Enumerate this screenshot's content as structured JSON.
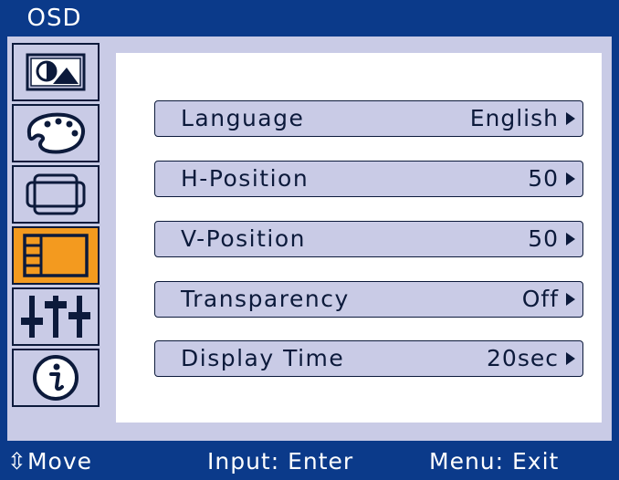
{
  "title": "OSD",
  "sidebar": {
    "items": [
      {
        "icon": "picture-icon",
        "active": false
      },
      {
        "icon": "color-palette-icon",
        "active": false
      },
      {
        "icon": "geometry-icon",
        "active": false
      },
      {
        "icon": "osd-settings-icon",
        "active": true
      },
      {
        "icon": "sliders-icon",
        "active": false
      },
      {
        "icon": "info-icon",
        "active": false
      }
    ]
  },
  "menu": {
    "items": [
      {
        "label": "Language",
        "value": "English"
      },
      {
        "label": "H-Position",
        "value": "50"
      },
      {
        "label": "V-Position",
        "value": "50"
      },
      {
        "label": "Transparency",
        "value": "Off"
      },
      {
        "label": "Display Time",
        "value": "20sec"
      }
    ]
  },
  "footer": {
    "move": "Move",
    "enter": "Input: Enter",
    "exit": "Menu: Exit"
  },
  "colors": {
    "frame": "#0b3a8a",
    "panel": "#c9cbe6",
    "active": "#f39a1f",
    "text": "#0c1a3b"
  }
}
